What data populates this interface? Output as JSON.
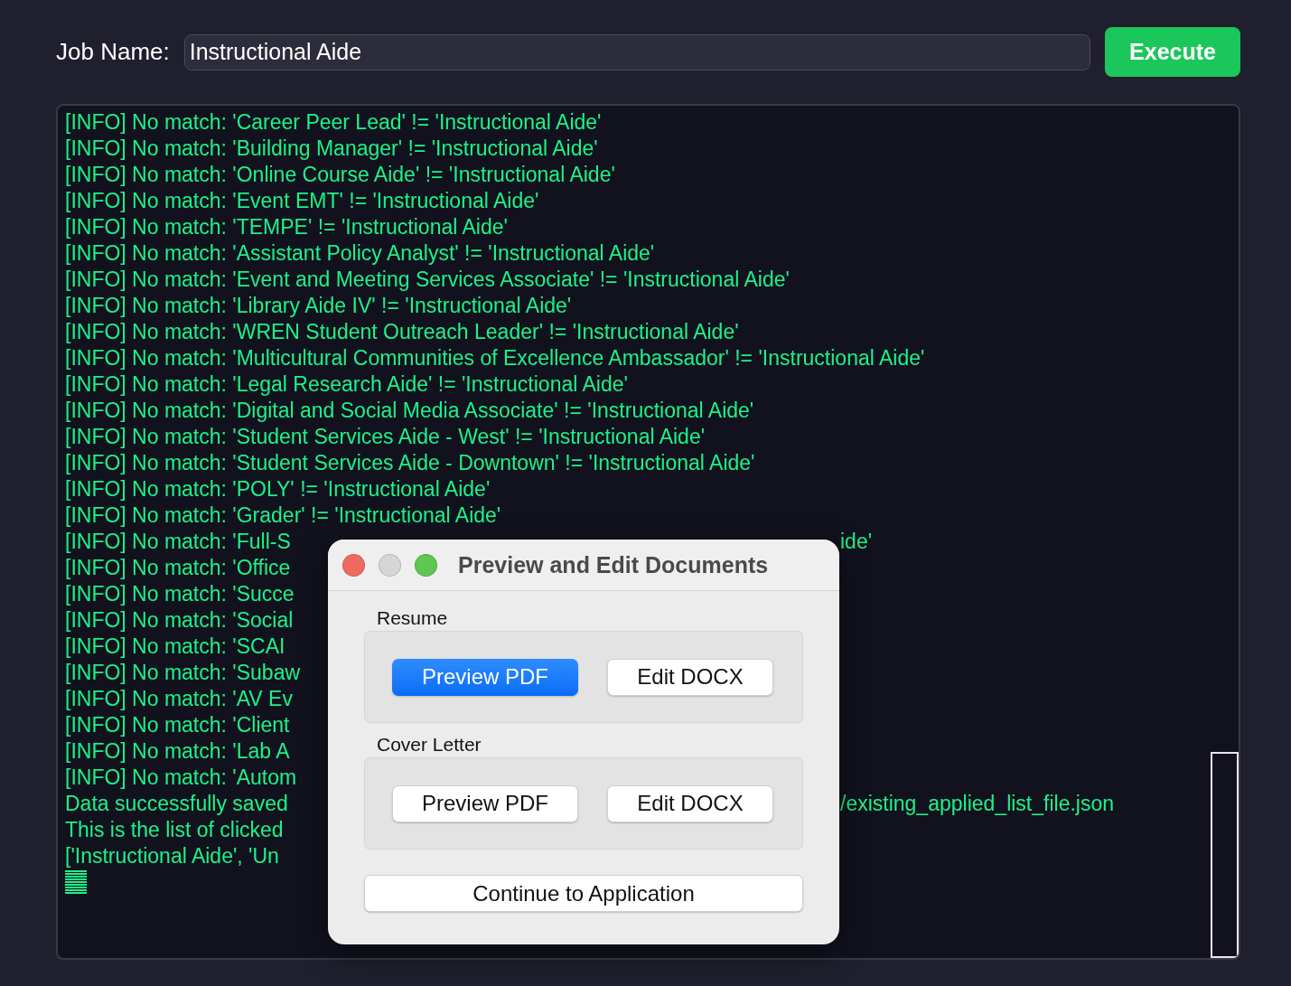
{
  "job_name": {
    "label": "Job Name:",
    "value": "Instructional Aide"
  },
  "execute_button": "Execute",
  "log": {
    "lines": [
      {
        "kind": "full",
        "text": "[INFO] No match: 'Career Peer Lead' != 'Instructional Aide'"
      },
      {
        "kind": "full",
        "text": "[INFO] No match: 'Building Manager' != 'Instructional Aide'"
      },
      {
        "kind": "full",
        "text": "[INFO] No match: 'Online Course Aide' != 'Instructional Aide'"
      },
      {
        "kind": "full",
        "text": "[INFO] No match: 'Event EMT' != 'Instructional Aide'"
      },
      {
        "kind": "full",
        "text": "[INFO] No match: 'TEMPE' != 'Instructional Aide'"
      },
      {
        "kind": "full",
        "text": "[INFO] No match: 'Assistant Policy Analyst' != 'Instructional Aide'"
      },
      {
        "kind": "full",
        "text": "[INFO] No match: 'Event and Meeting Services Associate' != 'Instructional Aide'"
      },
      {
        "kind": "full",
        "text": "[INFO] No match: 'Library Aide IV' != 'Instructional Aide'"
      },
      {
        "kind": "full",
        "text": "[INFO] No match: 'WREN Student Outreach Leader' != 'Instructional Aide'"
      },
      {
        "kind": "full",
        "text": "[INFO] No match: 'Multicultural Communities of Excellence Ambassador' != 'Instructional Aide'"
      },
      {
        "kind": "full",
        "text": "[INFO] No match: 'Legal Research Aide' != 'Instructional Aide'"
      },
      {
        "kind": "full",
        "text": "[INFO] No match: 'Digital and Social Media Associate' != 'Instructional Aide'"
      },
      {
        "kind": "full",
        "text": "[INFO] No match: 'Student Services Aide - West' != 'Instructional Aide'"
      },
      {
        "kind": "full",
        "text": "[INFO] No match: 'Student Services Aide - Downtown' != 'Instructional Aide'"
      },
      {
        "kind": "full",
        "text": "[INFO] No match: 'POLY' != 'Instructional Aide'"
      },
      {
        "kind": "full",
        "text": "[INFO] No match: 'Grader' != 'Instructional Aide'"
      },
      {
        "kind": "split",
        "text": "[INFO] No match: 'Full-S",
        "right": "ide'"
      },
      {
        "kind": "split",
        "text": "[INFO] No match: 'Office"
      },
      {
        "kind": "split",
        "text": "[INFO] No match: 'Succe"
      },
      {
        "kind": "split",
        "text": "[INFO] No match: 'Social"
      },
      {
        "kind": "split",
        "text": "[INFO] No match: 'SCAI"
      },
      {
        "kind": "split",
        "text": "[INFO] No match: 'Subaw"
      },
      {
        "kind": "split",
        "text": "[INFO] No match: 'AV Ev"
      },
      {
        "kind": "split",
        "text": "[INFO] No match: 'Client"
      },
      {
        "kind": "split",
        "text": "[INFO] No match: 'Lab A"
      },
      {
        "kind": "split",
        "text": "[INFO] No match: 'Autom"
      },
      {
        "kind": "split",
        "text": "Data successfully saved",
        "right": "/existing_applied_list_file.json"
      },
      {
        "kind": "split",
        "text": "This is the list of clicked"
      },
      {
        "kind": "split",
        "text": "['Instructional Aide', 'Un"
      },
      {
        "kind": "cursor"
      }
    ]
  },
  "dialog": {
    "title": "Preview and Edit Documents",
    "sections": [
      {
        "label": "Resume",
        "buttons": [
          {
            "label": "Preview PDF",
            "default": true
          },
          {
            "label": "Edit DOCX",
            "default": false
          }
        ]
      },
      {
        "label": "Cover Letter",
        "buttons": [
          {
            "label": "Preview PDF",
            "default": false
          },
          {
            "label": "Edit DOCX",
            "default": false
          }
        ]
      }
    ],
    "continue_button": "Continue to Application"
  }
}
